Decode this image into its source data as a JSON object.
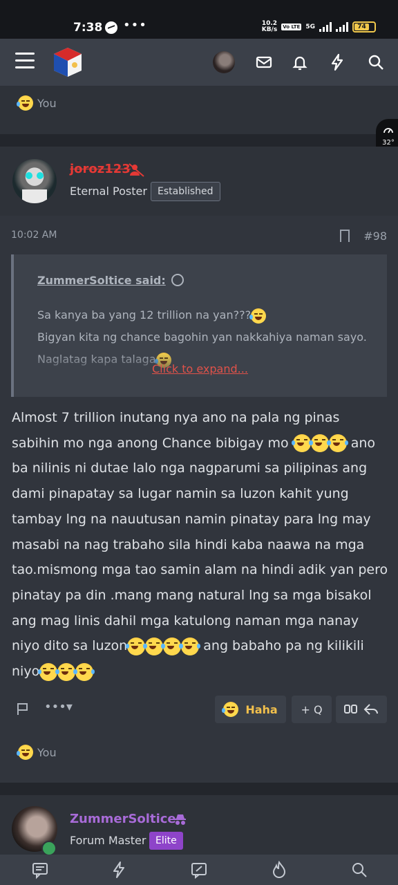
{
  "status_bar": {
    "time": "7:38",
    "speed_value": "10.2",
    "speed_unit": "KB/s",
    "network": "5G",
    "battery": "74"
  },
  "header": {
    "icons": [
      "menu-icon",
      "site-logo",
      "user-avatar",
      "inbox-icon",
      "bell-icon",
      "bolt-icon",
      "search-icon"
    ]
  },
  "top_reactions": {
    "label": "You"
  },
  "temperature": {
    "value": "32°"
  },
  "post": {
    "author": "joroz123",
    "user_title": "Eternal Poster",
    "badge": "Established",
    "time": "10:02 AM",
    "post_number": "#98",
    "quote": {
      "title": "ZummerSoltice said:",
      "line1": "Sa kanya ba yang 12 trillion na yan???",
      "line2": "Bigyan kita ng chance bagohin yan nakkahiya naman sayo. Naglatag kapa talaga",
      "expand": "Click to expand..."
    },
    "message_parts": [
      "Almost 7 trillion inutang nya ano na pala ng pinas sabihin mo nga anong Chance bibigay mo ",
      " ano ba nilinis ni dutae lalo nga nagparumi sa pilipinas ang dami pinapatay sa lugar namin sa luzon kahit yung tambay lng na nauutusan namin pinatay para lng may masabi na nag trabaho sila hindi kaba naawa na mga tao.mismong mga tao samin alam na hindi adik yan pero pinatay pa din .mang mang natural lng sa mga bisakol ang mag linis dahil mga katulong naman mga nanay niyo dito sa luzon",
      " ang babaho pa ng kilikili niyo"
    ],
    "actions": {
      "reaction": "Haha",
      "multiquote": "+ Q"
    },
    "reactions_label": "You"
  },
  "next_post": {
    "author": "ZummerSoltice",
    "user_title": "Forum Master",
    "badge": "Elite"
  },
  "colors": {
    "author_red": "#e53935",
    "author_purple": "#a86bd8",
    "haha_yellow": "#f2c04c",
    "elite_badge": "#8e44c9"
  }
}
